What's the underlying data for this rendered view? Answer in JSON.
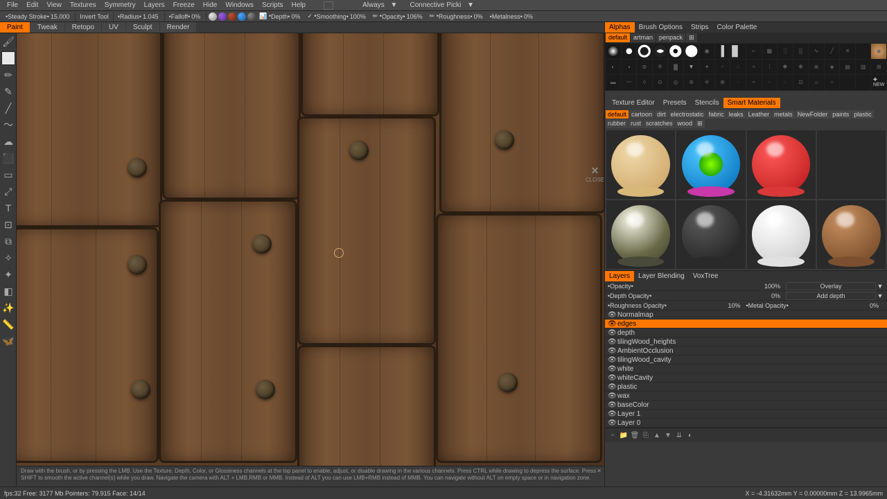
{
  "menu": [
    "File",
    "Edit",
    "View",
    "Textures",
    "Symmetry",
    "Layers",
    "Freeze",
    "Hide",
    "Windows",
    "Scripts",
    "Help"
  ],
  "menuRight": {
    "dropdown1": "Always",
    "dropdown2": "Connective Picki"
  },
  "topbar": {
    "steady": "Steady Stroke",
    "steadyVal": "15.000",
    "invert": "Invert Tool",
    "radius": "Radius",
    "radiusVal": "1.045",
    "falloff": "Falloff",
    "falloffVal": "0%",
    "depth": "Depth",
    "depthVal": "0%",
    "smoothing": "Smoothing",
    "smoothingVal": "100%",
    "opacity": "Opacity",
    "opacityVal": "106%",
    "roughness": "Roughness",
    "roughnessVal": "0%",
    "metalness": "Metalness",
    "metalnessVal": "0%"
  },
  "modeTabs": [
    "Paint",
    "Tweak",
    "Retopo",
    "UV",
    "Sculpt",
    "Render"
  ],
  "activeMode": "Paint",
  "camera": "[Camera]",
  "rightTabs": [
    "Alphas",
    "Brush Options",
    "Strips",
    "Color Palette"
  ],
  "activeRightTab": "Alphas",
  "alphaSubTabs": [
    "default",
    "artman",
    "penpack"
  ],
  "activeAlphaSub": "default",
  "presetTabs": [
    "Texture Editor",
    "Presets",
    "Stencils",
    "Smart Materials"
  ],
  "activePresetTab": "Smart Materials",
  "categories": [
    "default",
    "cartoon",
    "dirt",
    "electrostatic",
    "fabric",
    "leaks",
    "Leather",
    "metals",
    "NewFolder",
    "paints",
    "plastic",
    "rubber",
    "rust",
    "scratches",
    "wood"
  ],
  "activeCategory": "default",
  "layerTabs": [
    "Layers",
    "Layer Blending",
    "VoxTree"
  ],
  "activeLayerTab": "Layers",
  "layerProps": {
    "opacity": {
      "label": "Opacity",
      "value": "100%",
      "mode": "Overlay"
    },
    "depthOpacity": {
      "label": "Depth Opacity",
      "value": "0%",
      "mode": "Add depth"
    },
    "roughOpacity": {
      "label": "Roughness Opacity",
      "value": "10%",
      "metalLabel": "Metal Opacity",
      "metalValue": "0%"
    }
  },
  "layers": [
    {
      "name": "Normalmap"
    },
    {
      "name": "edges",
      "selected": true
    },
    {
      "name": "depth"
    },
    {
      "name": "tilingWood_heights"
    },
    {
      "name": "AmbientOcclusion"
    },
    {
      "name": "tilingWood_cavity"
    },
    {
      "name": "white"
    },
    {
      "name": "whiteCavity"
    },
    {
      "name": "plastic"
    },
    {
      "name": "wax"
    },
    {
      "name": "baseColor"
    },
    {
      "name": "Layer 1"
    },
    {
      "name": "Layer 0"
    }
  ],
  "closeLabel": "CLOSE",
  "hint": "Draw with the brush, or by pressing the LMB. Use the Texture, Depth, Color, or Glossiness channels at the top panel to enable, adjust, or disable drawing in the various channels. Press CTRL while drawing to depress the surface. Press SHIFT to smooth the active channel(s) while you draw. Navigate the camera with ALT + LMB,RMB or MMB. Instead of ALT you can use LMB+RMB instead of MMB. You can navigate without ALT on empty space or in navigation zone.",
  "statusLeft": "fps:32    Free: 3177 Mb Pointers: 79.915  Face: 14/14",
  "statusRight": "X = -4.31632mm  Y = 0.00000mm  Z = 13.9965mm"
}
